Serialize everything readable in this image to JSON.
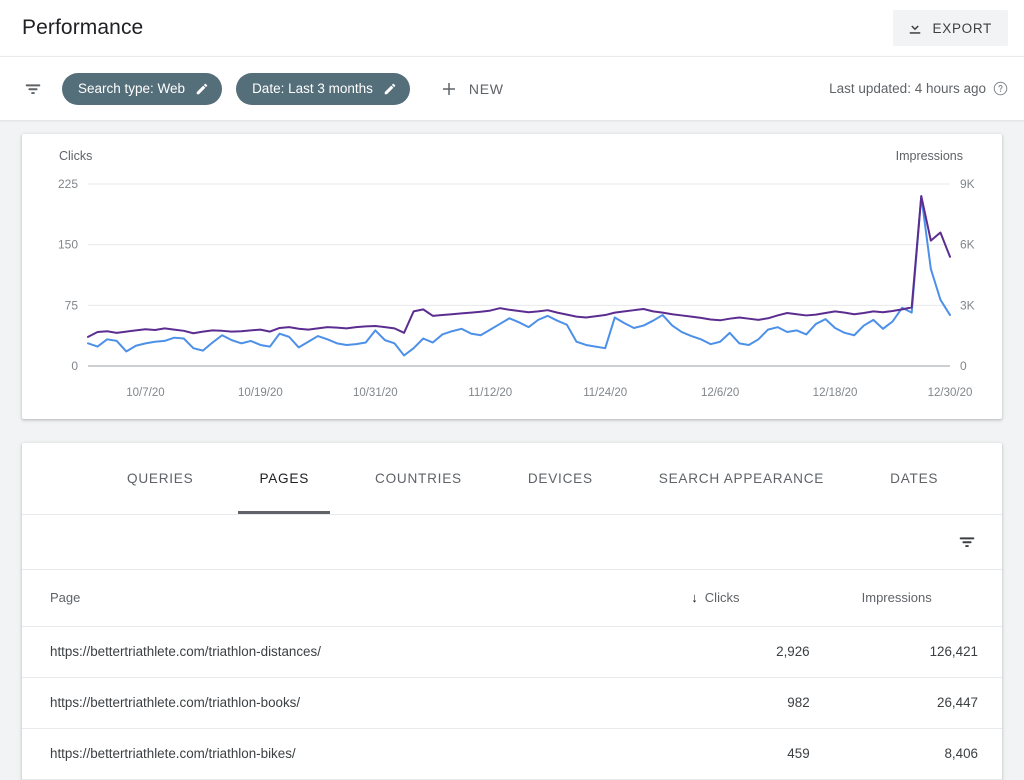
{
  "header": {
    "title": "Performance",
    "export_label": "EXPORT",
    "export_icon": "download-icon"
  },
  "toolbar": {
    "filter_icon": "filter-funnel-icon",
    "chips": [
      {
        "label": "Search type: Web",
        "icon": "pencil-edit-icon"
      },
      {
        "label": "Date: Last 3 months",
        "icon": "pencil-edit-icon"
      }
    ],
    "new_label": "NEW",
    "new_icon": "plus-icon",
    "last_updated": "Last updated: 4 hours ago",
    "help_icon": "help-circle-icon"
  },
  "table": {
    "tabs": [
      {
        "label": "QUERIES",
        "active": false
      },
      {
        "label": "PAGES",
        "active": true
      },
      {
        "label": "COUNTRIES",
        "active": false
      },
      {
        "label": "DEVICES",
        "active": false
      },
      {
        "label": "SEARCH APPEARANCE",
        "active": false
      },
      {
        "label": "DATES",
        "active": false
      }
    ],
    "filter_icon": "filter-funnel-icon",
    "columns": {
      "page": "Page",
      "clicks": "Clicks",
      "impressions": "Impressions",
      "sort_arrow": "↓"
    },
    "rows": [
      {
        "page": "https://bettertriathlete.com/triathlon-distances/",
        "clicks": "2,926",
        "impressions": "126,421"
      },
      {
        "page": "https://bettertriathlete.com/triathlon-books/",
        "clicks": "982",
        "impressions": "26,447"
      },
      {
        "page": "https://bettertriathlete.com/triathlon-bikes/",
        "clicks": "459",
        "impressions": "8,406"
      }
    ]
  },
  "colors": {
    "clicks": "#4d90e8",
    "impressions": "#5c2d91",
    "chip_bg": "#546e7a",
    "accent_text": "#3c4043",
    "page_bg": "#f1f3f4"
  },
  "chart_data": {
    "type": "line",
    "title": "",
    "xlabel": "",
    "grid": true,
    "legend": "axis-titles",
    "x_tick_labels": [
      "10/7/20",
      "10/19/20",
      "10/31/20",
      "11/12/20",
      "11/24/20",
      "12/6/20",
      "12/18/20",
      "12/30/20"
    ],
    "x_tick_indices": [
      6,
      18,
      30,
      42,
      54,
      66,
      78,
      90
    ],
    "x_start_date": "10/1/20",
    "x_end_date": "12/31/20",
    "axes": [
      {
        "name": "Clicks",
        "side": "left",
        "ticks": [
          0,
          75,
          150,
          225
        ],
        "tick_labels": [
          "0",
          "75",
          "150",
          "225"
        ],
        "range": [
          0,
          225
        ],
        "color": "#4d90e8"
      },
      {
        "name": "Impressions",
        "side": "right",
        "ticks": [
          0,
          3000,
          6000,
          9000
        ],
        "tick_labels": [
          "0",
          "3K",
          "6K",
          "9K"
        ],
        "range": [
          0,
          9000
        ],
        "color": "#5c2d91"
      }
    ],
    "series": [
      {
        "name": "Clicks",
        "axis": "left",
        "color": "#4d90e8",
        "values": [
          28,
          24,
          33,
          31,
          18,
          25,
          28,
          30,
          31,
          35,
          34,
          22,
          19,
          29,
          38,
          32,
          28,
          31,
          26,
          24,
          40,
          36,
          23,
          30,
          37,
          33,
          28,
          26,
          27,
          29,
          44,
          32,
          28,
          13,
          22,
          34,
          29,
          39,
          43,
          46,
          40,
          38,
          45,
          52,
          59,
          54,
          48,
          57,
          62,
          56,
          51,
          30,
          26,
          24,
          22,
          60,
          53,
          47,
          50,
          56,
          63,
          50,
          42,
          37,
          33,
          27,
          30,
          41,
          28,
          26,
          33,
          45,
          48,
          42,
          44,
          39,
          52,
          58,
          47,
          41,
          38,
          50,
          57,
          46,
          55,
          72,
          66,
          210,
          120,
          82,
          63
        ]
      },
      {
        "name": "Impressions",
        "axis": "right",
        "color": "#5c2d91",
        "values": [
          1440,
          1680,
          1720,
          1640,
          1700,
          1760,
          1820,
          1780,
          1860,
          1800,
          1740,
          1620,
          1700,
          1760,
          1740,
          1700,
          1720,
          1760,
          1800,
          1700,
          1880,
          1920,
          1840,
          1800,
          1860,
          1920,
          1900,
          1860,
          1920,
          1960,
          1980,
          1920,
          1860,
          1640,
          2700,
          2800,
          2480,
          2520,
          2560,
          2600,
          2640,
          2680,
          2740,
          2860,
          2780,
          2720,
          2660,
          2700,
          2760,
          2640,
          2540,
          2440,
          2400,
          2460,
          2520,
          2640,
          2700,
          2760,
          2820,
          2700,
          2640,
          2560,
          2500,
          2440,
          2380,
          2300,
          2260,
          2340,
          2400,
          2340,
          2280,
          2360,
          2500,
          2620,
          2560,
          2500,
          2540,
          2620,
          2700,
          2640,
          2560,
          2620,
          2700,
          2660,
          2720,
          2800,
          2900,
          8400,
          6200,
          6600,
          5400
        ]
      }
    ]
  }
}
